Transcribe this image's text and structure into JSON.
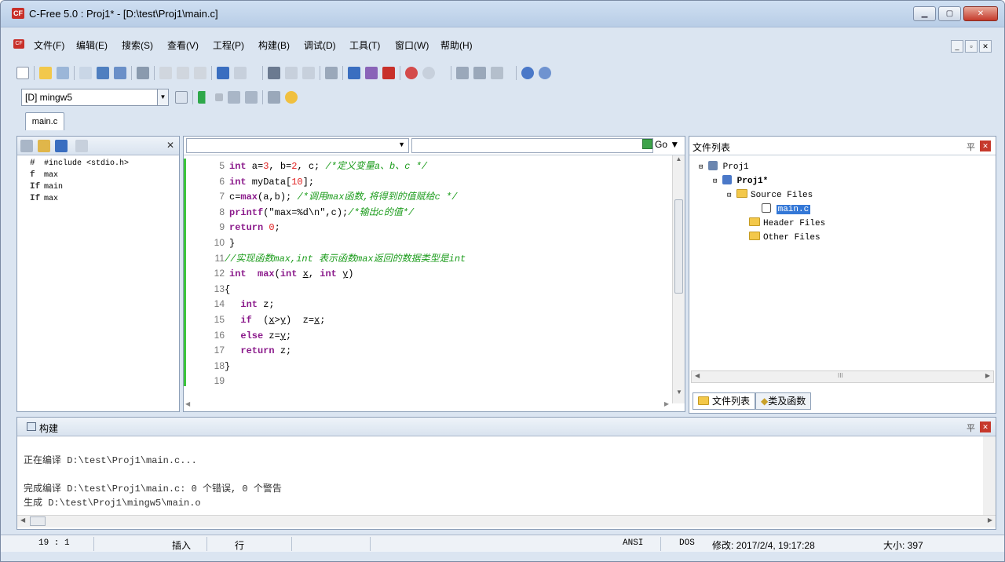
{
  "window": {
    "title": "C-Free 5.0 : Proj1* - [D:\\test\\Proj1\\main.c]",
    "app_icon_text": "CF"
  },
  "menu": [
    "文件(F)",
    "编辑(E)",
    "搜索(S)",
    "查看(V)",
    "工程(P)",
    "构建(B)",
    "调试(D)",
    "工具(T)",
    "窗口(W)",
    "帮助(H)"
  ],
  "toolbar": {
    "compiler": "[D] mingw5",
    "go_label": "Go"
  },
  "tabs": [
    "main.c"
  ],
  "symbols": {
    "items": [
      {
        "icon": "#",
        "label": "#include <stdio.h>"
      },
      {
        "icon": "f",
        "label": "max"
      },
      {
        "icon": "If",
        "label": "main"
      },
      {
        "icon": "If",
        "label": "max"
      }
    ]
  },
  "editor": {
    "lines": [
      {
        "n": "5",
        "html": "<span class='kw'>int</span> a=<span class='num'>3</span>, b=<span class='num'>2</span>, c; <span class='cm'>/*定义变量a、b、c */</span>"
      },
      {
        "n": "6",
        "html": "<span class='kw'>int</span> myData[<span class='num'>10</span>];"
      },
      {
        "n": "7",
        "html": "c=<span class='kw'>max</span>(a,b); <span class='cm'>/*调用max函数,将得到的值赋给c */</span>"
      },
      {
        "n": "8",
        "html": "<span class='kw'>printf</span>(\"max=%d\\n\",c);<span class='cm'>/*输出c的值*/</span>"
      },
      {
        "n": "9",
        "html": "<span class='kw'>return</span> <span class='num'>0</span>;"
      },
      {
        "n": "10",
        "html": "}"
      },
      {
        "n": "11",
        "html": "<span class='cm'>//实现函数max,int 表示函数max返回的数据类型是int</span>",
        "indent": -1
      },
      {
        "n": "12",
        "html": "<span class='kw'>int</span>  <span class='kw'>max</span>(<span class='kw'>int</span> <u>x</u>, <span class='kw'>int</span> <u>y</u>)"
      },
      {
        "n": "13",
        "html": "{",
        "indent": -1
      },
      {
        "n": "14",
        "html": "  <span class='kw'>int</span> z;"
      },
      {
        "n": "15",
        "html": "  <span class='kw'>if</span>  (<u>x</u>&gt;<u>y</u>)  z=<u>x</u>;"
      },
      {
        "n": "16",
        "html": "  <span class='kw'>else</span> z=<u>y</u>;"
      },
      {
        "n": "17",
        "html": "  <span class='kw'>return</span> z;"
      },
      {
        "n": "18",
        "html": "}",
        "indent": -1
      },
      {
        "n": "19",
        "html": ""
      }
    ]
  },
  "files": {
    "header": "文件列表",
    "project_root": "Proj1",
    "project": "Proj1*",
    "folders": [
      "Source Files",
      "Header Files",
      "Other Files"
    ],
    "file": "main.c",
    "tabs": [
      "文件列表",
      "类及函数"
    ],
    "hscroll_mark": "III"
  },
  "build": {
    "header": "构建",
    "lines": [
      "正在编译 D:\\test\\Proj1\\main.c...",
      "",
      "完成编译 D:\\test\\Proj1\\main.c: 0 个错误, 0 个警告",
      "生成 D:\\test\\Proj1\\mingw5\\main.o"
    ]
  },
  "status": {
    "position": "19 :  1",
    "insert": "插入",
    "row": "行",
    "encoding": "ANSI",
    "lineend": "DOS",
    "modified": "修改: 2017/2/4, 19:17:28",
    "size": "大小: 397"
  }
}
